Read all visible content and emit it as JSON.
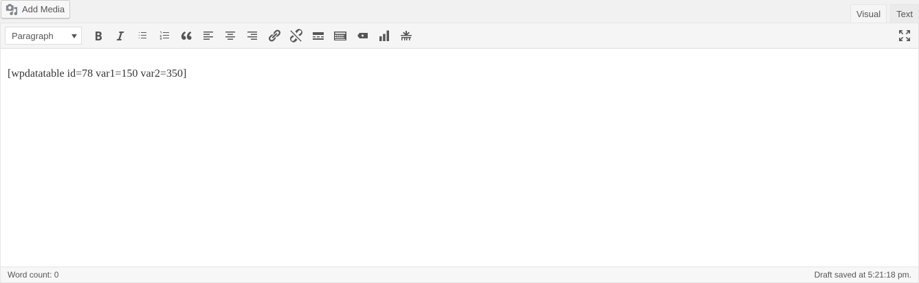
{
  "media": {
    "add_media_label": "Add Media",
    "icon": "add-media-icon"
  },
  "tabs": [
    {
      "label": "Visual",
      "active": true
    },
    {
      "label": "Text",
      "active": false
    }
  ],
  "toolbar": {
    "format_value": "Paragraph",
    "buttons": [
      "bold-icon",
      "italic-icon",
      "bulleted-list-icon",
      "numbered-list-icon",
      "blockquote-icon",
      "align-left-icon",
      "align-center-icon",
      "align-right-icon",
      "insert-link-icon",
      "remove-link-icon",
      "read-more-icon",
      "toolbar-toggle-icon",
      "wpdatatable-icon",
      "wpdatachart-icon",
      "insert-shortcode-icon"
    ],
    "fullscreen_icon": "fullscreen-icon"
  },
  "content": {
    "text": "[wpdatatable id=78 var1=150 var2=350]"
  },
  "status": {
    "word_count": "Word count: 0",
    "draft_saved": "Draft saved at 5:21:18 pm."
  }
}
